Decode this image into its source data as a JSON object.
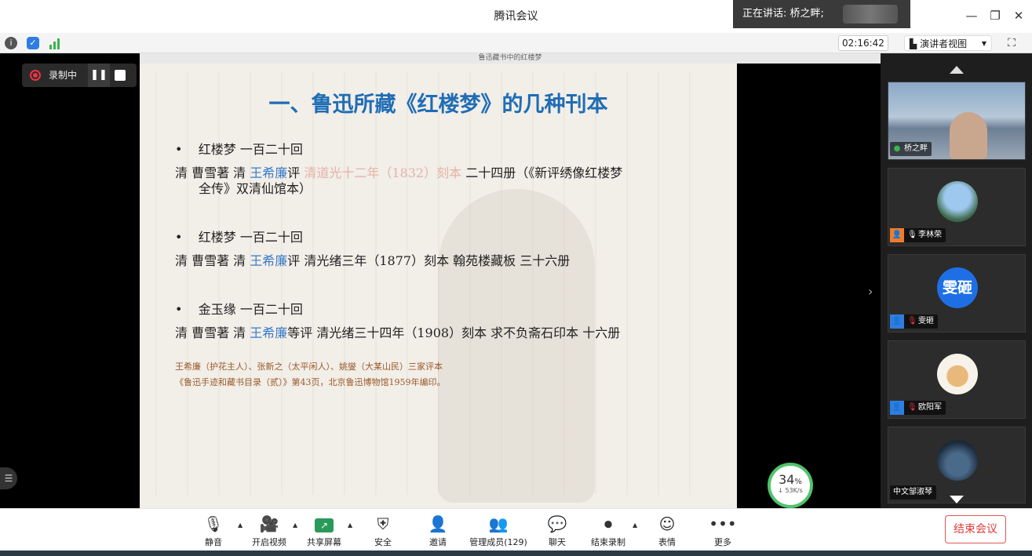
{
  "window": {
    "title": "腾讯会议",
    "speaking_label": "正在讲话: 桥之畔;"
  },
  "subbar": {
    "timer": "02:16:42",
    "view_mode": "演讲者视图"
  },
  "recording": {
    "label": "录制中"
  },
  "slide": {
    "header_text": "鲁迅藏书中的红楼梦",
    "title": "一、鲁迅所藏《红楼梦》的几种刊本",
    "entries": [
      {
        "bullet": "红楼梦  一百二十回",
        "line_a": "清  曹雪著  清 ",
        "editor": "王希廉",
        "line_b": "评 ",
        "faded": "清道光十二年（1832）刻本",
        "line_c": " 二十四册（《新评绣像红楼梦",
        "line_d": "全传》双清仙馆本）"
      },
      {
        "bullet": "红楼梦  一百二十回",
        "line_a": "清  曹雪著  清 ",
        "editor": "王希廉",
        "line_b": "评  清光绪三年（1877）刻本  翰苑楼藏板  三十六册"
      },
      {
        "bullet": "金玉缘  一百二十回",
        "line_a": "清  曹雪著  清 ",
        "editor": "王希廉",
        "line_b": "等评  清光绪三十四年（1908）刻本  求不负斋石印本  十六册"
      }
    ],
    "note1": "王希廉（护花主人）、张新之（太平闲人）、姚燮（大某山民）三家评本",
    "note2": "《鲁迅手迹和藏书目录（贰）》第43页，北京鲁迅博物馆1959年编印。"
  },
  "network": {
    "percent": "34",
    "unit": "%",
    "speed": "↓ 53K/s"
  },
  "participants": [
    {
      "name": "桥之畔"
    },
    {
      "name": "李林荣"
    },
    {
      "name": "雯砸",
      "avatar_text": "雯砸"
    },
    {
      "name": "欧阳军"
    },
    {
      "name": "中文邹淑琴"
    }
  ],
  "toolbar": {
    "mute": "静音",
    "video": "开启视频",
    "share": "共享屏幕",
    "security": "安全",
    "invite": "邀请",
    "members": "管理成员(129)",
    "chat": "聊天",
    "end_record": "结束录制",
    "emoji": "表情",
    "more": "更多",
    "end_meeting": "结束会议"
  },
  "colors": {
    "accent_blue": "#1f6db5",
    "end_red": "#e03a3a",
    "rec_red": "#e33344",
    "good_green": "#4fc36a"
  }
}
